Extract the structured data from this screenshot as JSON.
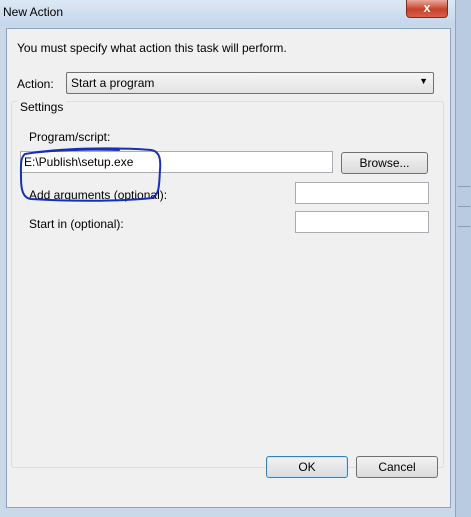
{
  "window": {
    "title": "New Action",
    "close_glyph": "x",
    "close_icon": "close-icon"
  },
  "dialog": {
    "instruction": "You must specify what action this task will perform.",
    "action_label": "Action:",
    "action_value": "Start a program",
    "action_dropdown_icon": "chevron-down-icon",
    "settings_label": "Settings",
    "program_label": "Program/script:",
    "program_value": "E:\\Publish\\setup.exe",
    "browse_label": "Browse...",
    "arguments_label": "Add arguments (optional):",
    "arguments_value": "",
    "start_in_label": "Start in (optional):",
    "start_in_value": "",
    "ok_label": "OK",
    "cancel_label": "Cancel"
  },
  "annotation": {
    "color": "#1a2fb8",
    "shape": "hand-drawn-outline"
  }
}
